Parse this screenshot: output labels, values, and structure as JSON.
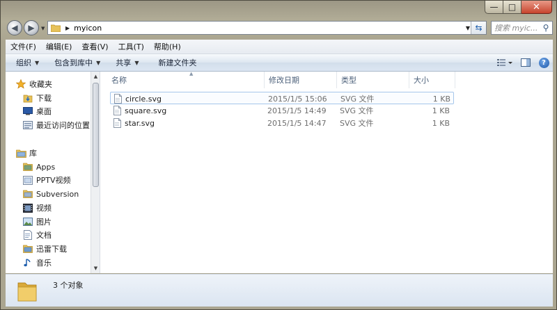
{
  "window": {
    "caption_buttons": {
      "minimize": "—",
      "maximize": "□",
      "close": "✕"
    }
  },
  "address": {
    "crumb": "myicon",
    "search_placeholder": "搜索 myic..."
  },
  "menu": [
    "文件(F)",
    "编辑(E)",
    "查看(V)",
    "工具(T)",
    "帮助(H)"
  ],
  "toolbar": {
    "organize": "组织",
    "include_library": "包含到库中",
    "share": "共享",
    "new_folder": "新建文件夹"
  },
  "nav": {
    "favorites": "收藏夹",
    "favorites_items": [
      "下载",
      "桌面",
      "最近访问的位置"
    ],
    "libraries": "库",
    "libraries_items": [
      "Apps",
      "PPTV视频",
      "Subversion",
      "视频",
      "图片",
      "文档",
      "迅雷下载",
      "音乐"
    ]
  },
  "columns": {
    "name": "名称",
    "date": "修改日期",
    "type": "类型",
    "size": "大小"
  },
  "files": [
    {
      "name": "circle.svg",
      "date": "2015/1/5 15:06",
      "type": "SVG 文件",
      "size": "1 KB",
      "selected": true
    },
    {
      "name": "square.svg",
      "date": "2015/1/5 14:49",
      "type": "SVG 文件",
      "size": "1 KB",
      "selected": false
    },
    {
      "name": "star.svg",
      "date": "2015/1/5 14:47",
      "type": "SVG 文件",
      "size": "1 KB",
      "selected": false
    }
  ],
  "status": {
    "count_text": "3 个对象"
  },
  "colors": {
    "selection_border": "#a5c6eb",
    "header_text": "#4c607a",
    "toolbar_top": "#f7fafd",
    "close_red": "#c7442d"
  }
}
